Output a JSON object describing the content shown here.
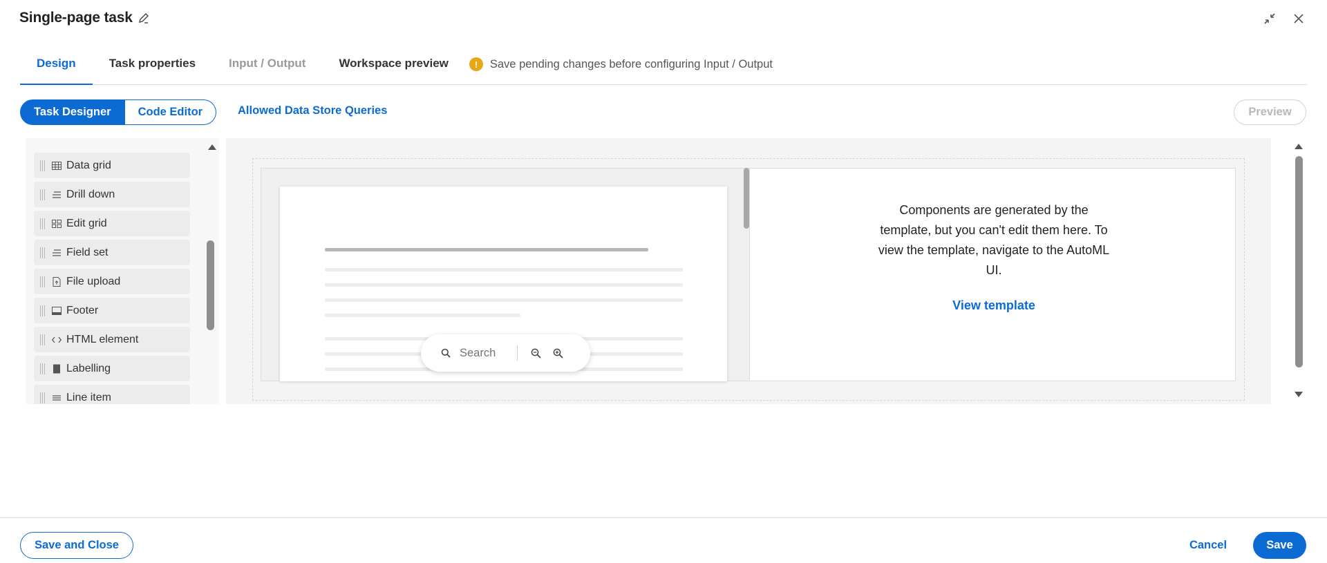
{
  "header": {
    "title": "Single-page task",
    "icons": {
      "edit": "pencil-icon",
      "collapse": "collapse-arrows-icon",
      "close": "close-icon"
    }
  },
  "tabs": [
    {
      "label": "Design",
      "state": "active"
    },
    {
      "label": "Task properties",
      "state": "normal"
    },
    {
      "label": "Input / Output",
      "state": "disabled"
    },
    {
      "label": "Workspace preview",
      "state": "normal"
    }
  ],
  "warning": {
    "icon": "!",
    "text": "Save pending changes before configuring Input / Output"
  },
  "toolbar": {
    "task_designer": "Task Designer",
    "code_editor": "Code Editor",
    "allowed_queries": "Allowed Data Store Queries",
    "preview": "Preview"
  },
  "palette": {
    "items": [
      {
        "label": "Data grid",
        "icon": "table-icon"
      },
      {
        "label": "Drill down",
        "icon": "lines-icon"
      },
      {
        "label": "Edit grid",
        "icon": "grid-icon"
      },
      {
        "label": "Field set",
        "icon": "lines-icon"
      },
      {
        "label": "File upload",
        "icon": "file-upload-icon"
      },
      {
        "label": "Footer",
        "icon": "footer-icon"
      },
      {
        "label": "HTML element",
        "icon": "code-icon"
      },
      {
        "label": "Labelling",
        "icon": "block-icon"
      },
      {
        "label": "Line item",
        "icon": "list-icon"
      }
    ]
  },
  "canvas": {
    "info_text": "Components are generated by the template, but you can't edit them here. To view the template, navigate to the AutoML UI.",
    "view_template": "View template",
    "search_placeholder": "Search"
  },
  "footer": {
    "save_and_close": "Save and Close",
    "cancel": "Cancel",
    "save": "Save"
  },
  "colors": {
    "accent": "#0b6bd3",
    "warning": "#e6a817",
    "disabled": "#9a9a9a"
  }
}
